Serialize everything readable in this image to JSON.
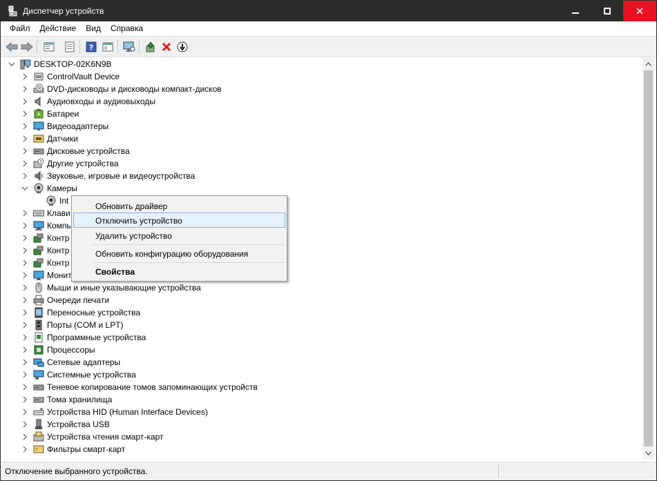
{
  "window": {
    "title": "Диспетчер устройств",
    "min_icon": "minimize-icon",
    "max_icon": "maximize-icon",
    "close_icon": "close-icon",
    "close_color": "#e81123",
    "titlebar_color": "#2b2b2b"
  },
  "menu": [
    "Файл",
    "Действие",
    "Вид",
    "Справка"
  ],
  "toolbar": {
    "icons": [
      "back-arrow-icon",
      "forward-arrow-icon",
      "properties-sheet-icon",
      "page-icon",
      "help-icon",
      "view-icon",
      "monitor-scan-icon",
      "update-driver-icon",
      "uninstall-x-icon",
      "disable-device-icon"
    ]
  },
  "tree": {
    "root": "DESKTOP-02K6N9B",
    "categories": [
      {
        "label": "ControlVault Device",
        "icon": "controlvault-icon"
      },
      {
        "label": "DVD-дисководы и дисководы компакт-дисков",
        "icon": "dvd-drive-icon"
      },
      {
        "label": "Аудиовходы и аудиовыходы",
        "icon": "speaker-icon"
      },
      {
        "label": "Батареи",
        "icon": "battery-icon"
      },
      {
        "label": "Видеоадаптеры",
        "icon": "display-adapter-icon"
      },
      {
        "label": "Датчики",
        "icon": "sensor-icon"
      },
      {
        "label": "Дисковые устройства",
        "icon": "disk-drive-icon"
      },
      {
        "label": "Другие устройства",
        "icon": "unknown-device-icon"
      },
      {
        "label": "Звуковые, игровые и видеоустройства",
        "icon": "sound-icon"
      },
      {
        "label": "Камеры",
        "icon": "camera-icon"
      }
    ],
    "camera_child": "Int",
    "after_categories": [
      {
        "label": "Клави",
        "icon": "keyboard-icon"
      },
      {
        "label": "Компь",
        "icon": "computer-icon"
      },
      {
        "label": "Контр",
        "icon": "controller-icon"
      },
      {
        "label": "Контр",
        "icon": "controller-icon"
      },
      {
        "label": "Контр",
        "icon": "controller-icon"
      },
      {
        "label": "Монит",
        "icon": "monitor-icon"
      },
      {
        "label": "Мыши и иные указывающие устройства",
        "icon": "mouse-icon"
      },
      {
        "label": "Очереди печати",
        "icon": "printer-icon"
      },
      {
        "label": "Переносные устройства",
        "icon": "portable-device-icon"
      },
      {
        "label": "Порты (COM и LPT)",
        "icon": "port-icon"
      },
      {
        "label": "Программные устройства",
        "icon": "software-device-icon"
      },
      {
        "label": "Процессоры",
        "icon": "processor-icon"
      },
      {
        "label": "Сетевые адаптеры",
        "icon": "network-adapter-icon"
      },
      {
        "label": "Системные устройства",
        "icon": "system-device-icon"
      },
      {
        "label": "Теневое копирование томов запоминающих устройств",
        "icon": "volume-shadow-icon"
      },
      {
        "label": "Тома хранилища",
        "icon": "storage-volume-icon"
      },
      {
        "label": "Устройства HID (Human Interface Devices)",
        "icon": "hid-icon"
      },
      {
        "label": "Устройства USB",
        "icon": "usb-icon"
      },
      {
        "label": "Устройства чтения смарт-карт",
        "icon": "smartcard-reader-icon"
      },
      {
        "label": "Фильтры смарт-карт",
        "icon": "smartcard-filter-icon"
      }
    ]
  },
  "context_menu": {
    "items": [
      "Обновить драйвер",
      "Отключить устройство",
      "Удалить устройство",
      "Обновить конфигурацию оборудования",
      "Свойства"
    ],
    "highlighted_index": 1,
    "highlight_color": "#e5f1fb"
  },
  "status": {
    "text": "Отключение выбранного устройства."
  }
}
